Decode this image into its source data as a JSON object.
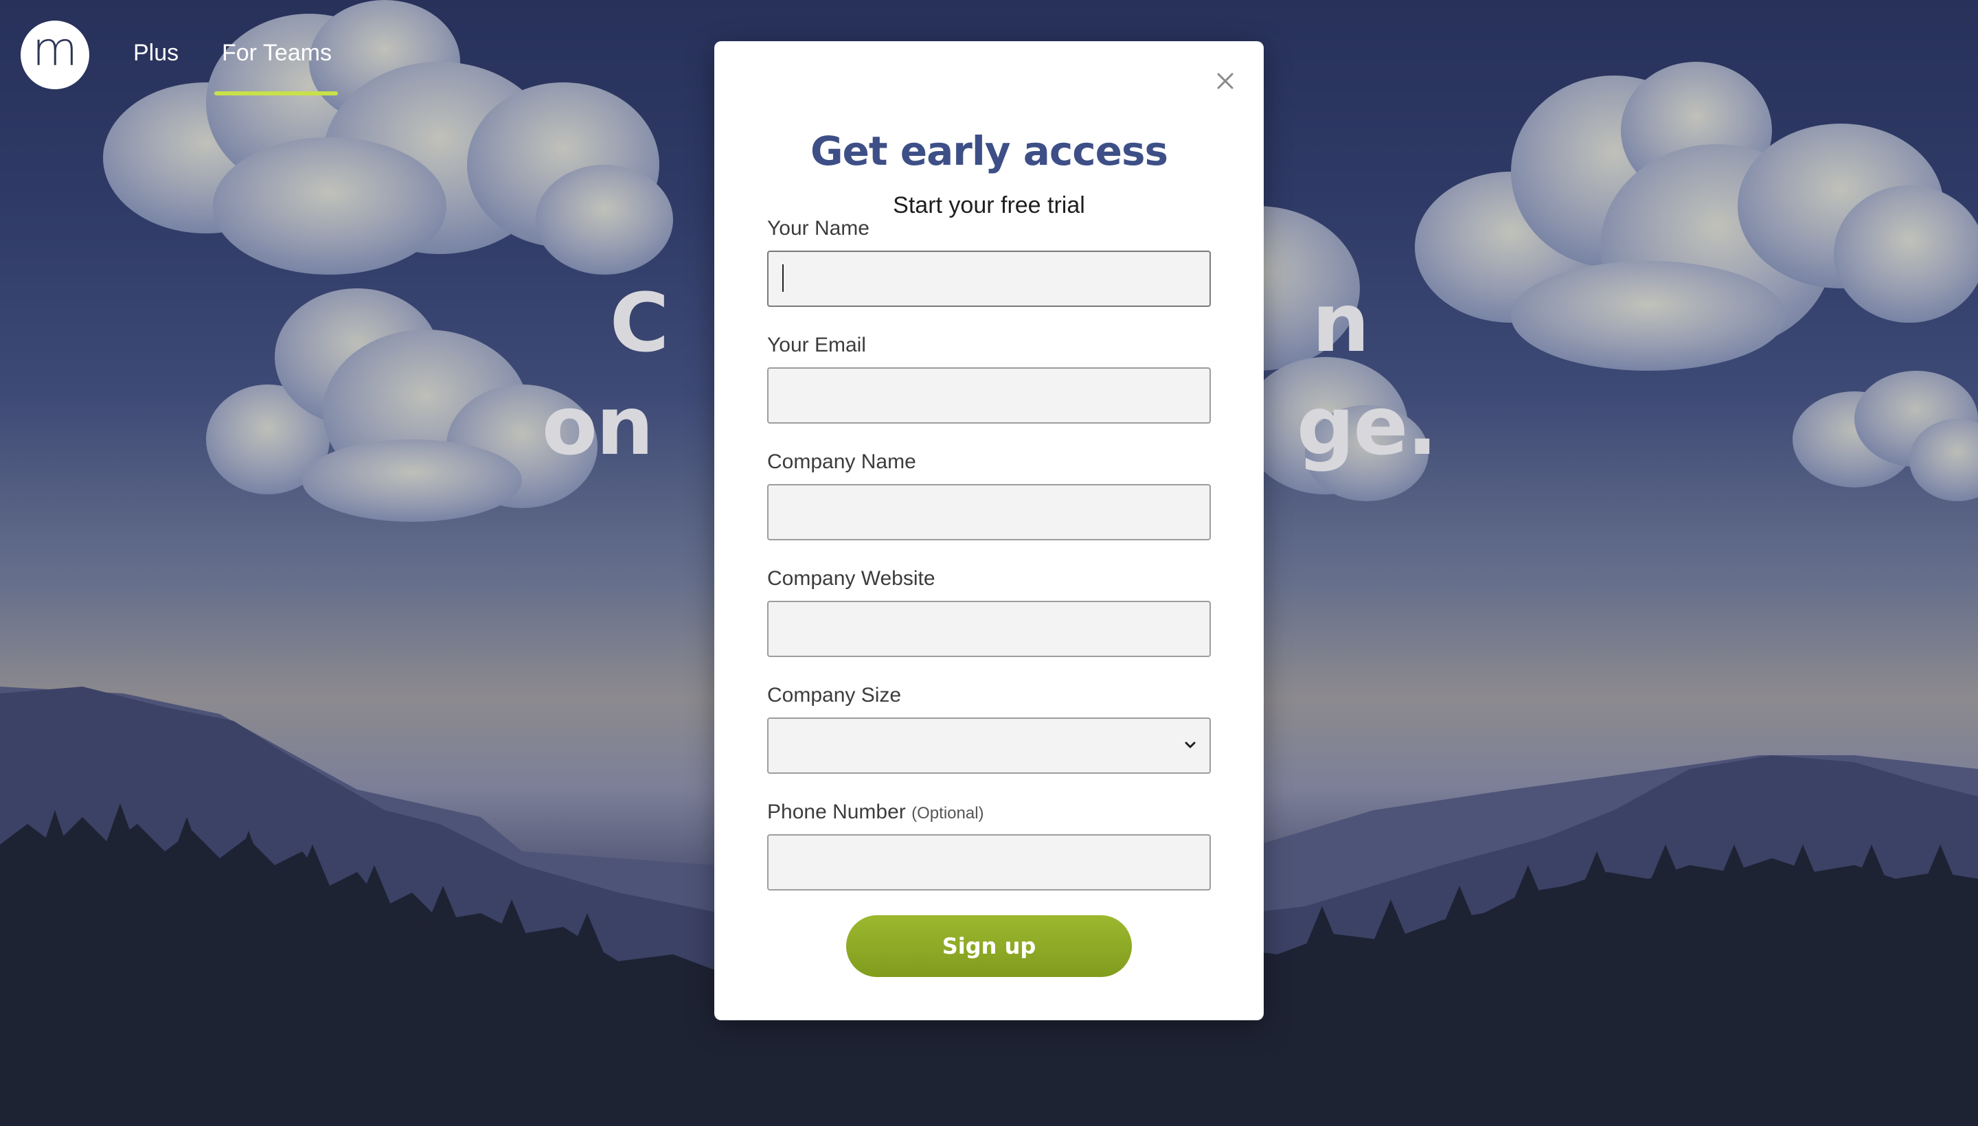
{
  "nav": {
    "logo_letter": "m",
    "items": [
      {
        "label": "Plus",
        "active": false
      },
      {
        "label": "For Teams",
        "active": true
      }
    ],
    "active_color": "#c8e04a"
  },
  "hero": {
    "line1": "C                        n",
    "line2": "on                        ge."
  },
  "modal": {
    "title": "Get early access",
    "subtitle": "Start your free trial",
    "close_icon": "close-icon",
    "fields": {
      "name": {
        "label": "Your Name",
        "value": ""
      },
      "email": {
        "label": "Your Email",
        "value": ""
      },
      "company_name": {
        "label": "Company Name",
        "value": ""
      },
      "company_website": {
        "label": "Company Website",
        "value": ""
      },
      "company_size": {
        "label": "Company Size",
        "value": ""
      },
      "phone": {
        "label": "Phone Number",
        "optional": "(Optional)",
        "value": ""
      }
    },
    "submit_label": "Sign up",
    "title_color": "#3d4f86",
    "button_color": "#8fab25"
  }
}
